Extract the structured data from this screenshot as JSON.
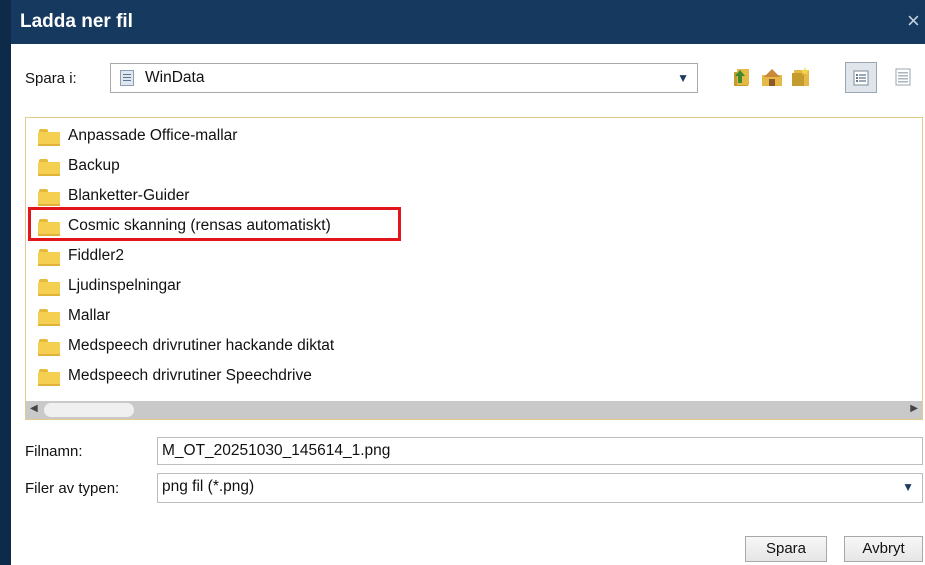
{
  "window": {
    "title": "Ladda ner fil",
    "close_glyph": "×"
  },
  "toolbar": {
    "save_in_label": "Spara i:",
    "location_value": "WinData",
    "icons": [
      "folder-up-icon",
      "home-folder-icon",
      "new-folder-icon",
      "list-view-icon",
      "details-view-icon"
    ]
  },
  "files": [
    {
      "name": "Anpassade Office-mallar"
    },
    {
      "name": "Backup"
    },
    {
      "name": "Blanketter-Guider"
    },
    {
      "name": "Cosmic skanning (rensas automatiskt)",
      "highlighted": true
    },
    {
      "name": "Fiddler2"
    },
    {
      "name": "Ljudinspelningar"
    },
    {
      "name": "Mallar"
    },
    {
      "name": "Medspeech drivrutiner hackande diktat"
    },
    {
      "name": "Medspeech drivrutiner Speechdrive"
    }
  ],
  "form": {
    "filename_label": "Filnamn:",
    "filename_value": "M_OT_20251030_145614_1.png",
    "filetype_label": "Filer av typen:",
    "filetype_value": "png fil (*.png)"
  },
  "buttons": {
    "save": "Spara",
    "cancel": "Avbryt"
  },
  "colors": {
    "titlebar": "#163a5f",
    "highlight": "#e0161b",
    "folder": "#f5cf52"
  }
}
